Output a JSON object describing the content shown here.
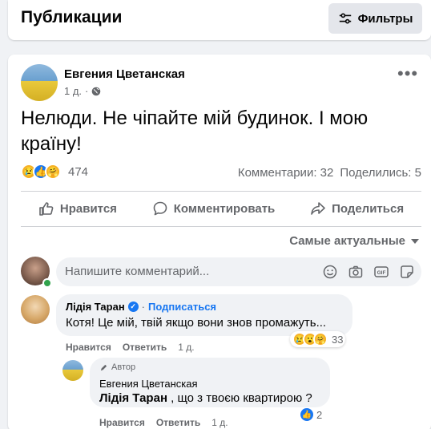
{
  "header": {
    "title": "Публикации",
    "filters_label": "Фильтры"
  },
  "post": {
    "author": "Евгения Цветанская",
    "time": "1 д.",
    "privacy_icon": "globe-icon",
    "text": "Нелюди. Не чіпайте мій будинок. І мою країну!",
    "reactions": {
      "icons": [
        "sad-reaction-icon",
        "like-reaction-icon",
        "care-reaction-icon"
      ],
      "count": "474"
    },
    "comments_count": "Комментарии: 32",
    "shares_count": "Поделились: 5",
    "actions": {
      "like": "Нравится",
      "comment": "Комментировать",
      "share": "Поделиться"
    }
  },
  "comments": {
    "sort_label": "Самые актуальные",
    "input_placeholder": "Напишите комментарий...",
    "input_icons": [
      "emoji-icon",
      "camera-icon",
      "gif-icon",
      "sticker-icon"
    ],
    "items": [
      {
        "author": "Лідія Таран",
        "verified": true,
        "dot": "·",
        "subscribe_label": "Подписаться",
        "text": "Котя! Це мій, твій якщо вони знов промажуть...",
        "reactions_count": "33",
        "like_label": "Нравится",
        "reply_label": "Ответить",
        "time": "1 д.",
        "replies": [
          {
            "author_tag": "Автор",
            "author": "Евгения Цветанская",
            "mention": "Лідія Таран",
            "text": " , що з твоєю квартирою ?",
            "reactions_count": "2",
            "like_label": "Нравится",
            "reply_label": "Ответить",
            "time": "1 д."
          }
        ]
      }
    ]
  },
  "colors": {
    "accent": "#1877f2",
    "background": "#f0f2f5",
    "secondary_text": "#65676b"
  }
}
